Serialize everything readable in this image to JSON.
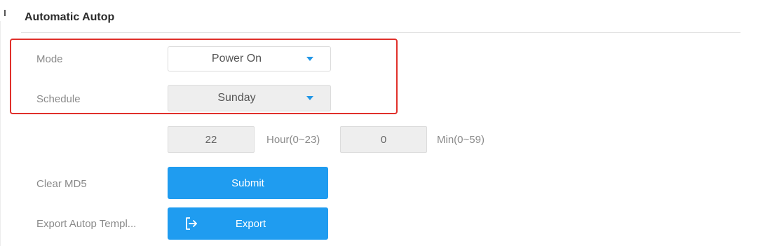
{
  "section": {
    "title": "Automatic Autop"
  },
  "mode": {
    "label": "Mode",
    "value": "Power On"
  },
  "schedule": {
    "label": "Schedule",
    "value": "Sunday"
  },
  "time": {
    "hour_value": "22",
    "hour_unit": "Hour(0~23)",
    "min_value": "0",
    "min_unit": "Min(0~59)"
  },
  "clear_md5": {
    "label": "Clear MD5",
    "button": "Submit"
  },
  "export_template": {
    "label": "Export Autop Templ...",
    "button": "Export",
    "icon": "export-icon"
  },
  "colors": {
    "accent": "#1f9cf0",
    "highlight": "#e0302b",
    "caret": "#2196e6"
  }
}
